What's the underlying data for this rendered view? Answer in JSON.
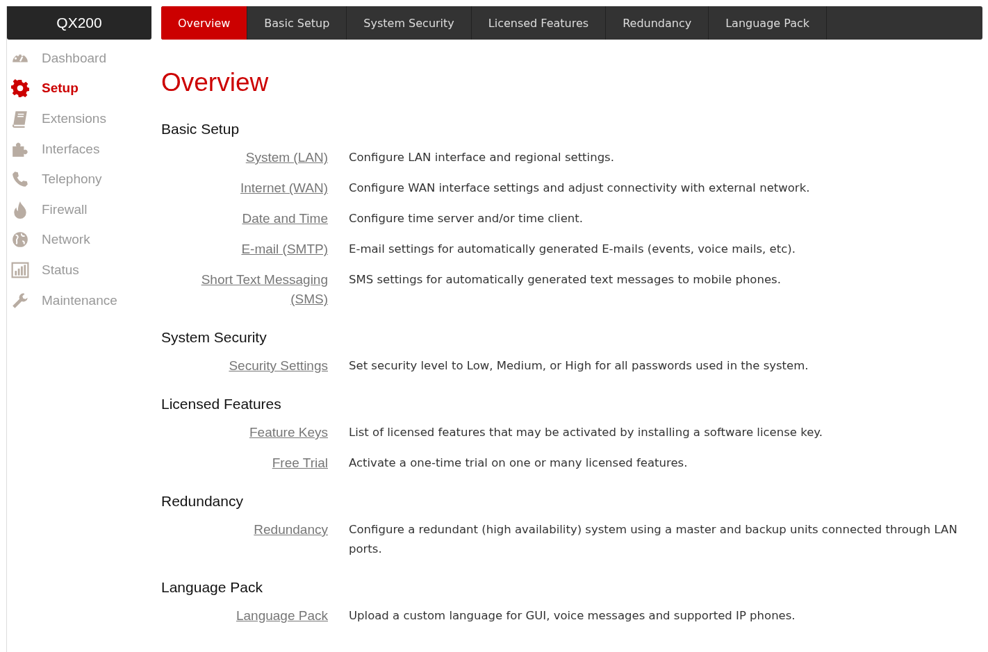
{
  "brand": "QX200",
  "tabs": [
    {
      "label": "Overview",
      "selected": true
    },
    {
      "label": "Basic Setup",
      "selected": false
    },
    {
      "label": "System Security",
      "selected": false
    },
    {
      "label": "Licensed Features",
      "selected": false
    },
    {
      "label": "Redundancy",
      "selected": false
    },
    {
      "label": "Language Pack",
      "selected": false
    }
  ],
  "sidebar": {
    "items": [
      {
        "label": "Dashboard",
        "kind": "dashboard",
        "selected": false
      },
      {
        "label": "Setup",
        "kind": "gear",
        "selected": true
      },
      {
        "label": "Extensions",
        "kind": "book",
        "selected": false
      },
      {
        "label": "Interfaces",
        "kind": "puzzle",
        "selected": false
      },
      {
        "label": "Telephony",
        "kind": "phone",
        "selected": false
      },
      {
        "label": "Firewall",
        "kind": "flame",
        "selected": false
      },
      {
        "label": "Network",
        "kind": "globe",
        "selected": false
      },
      {
        "label": "Status",
        "kind": "chart",
        "selected": false
      },
      {
        "label": "Maintenance",
        "kind": "wrench",
        "selected": false
      }
    ]
  },
  "page_title": "Overview",
  "sections": [
    {
      "heading": "Basic Setup",
      "rows": [
        {
          "link": "System (LAN)",
          "description": "Configure LAN interface and regional settings."
        },
        {
          "link": "Internet (WAN)",
          "description": "Configure WAN interface settings and adjust connectivity with external network."
        },
        {
          "link": "Date and Time",
          "description": "Configure time server and/or time client."
        },
        {
          "link": "E-mail (SMTP)",
          "description": "E-mail settings for automatically generated E-mails (events, voice mails, etc)."
        },
        {
          "link": "Short Text Messaging (SMS)",
          "description": "SMS settings for automatically generated text messages to mobile phones."
        }
      ]
    },
    {
      "heading": "System Security",
      "rows": [
        {
          "link": "Security Settings",
          "description": "Set security level to Low, Medium, or High for all passwords used in the system."
        }
      ]
    },
    {
      "heading": "Licensed Features",
      "rows": [
        {
          "link": "Feature Keys",
          "description": "List of licensed features that may be activated by installing a software license key."
        },
        {
          "link": "Free Trial",
          "description": "Activate a one-time trial on one or many licensed features."
        }
      ]
    },
    {
      "heading": "Redundancy",
      "rows": [
        {
          "link": "Redundancy",
          "description": "Configure a redundant (high availability) system using a master and backup units connected through LAN ports."
        }
      ]
    },
    {
      "heading": "Language Pack",
      "rows": [
        {
          "link": "Language Pack",
          "description": "Upload a custom language for GUI, voice messages and supported IP phones."
        }
      ]
    }
  ]
}
